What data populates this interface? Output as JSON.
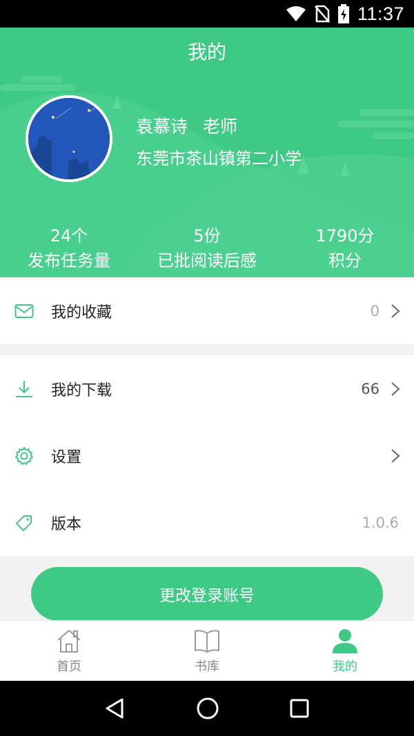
{
  "status_bar": {
    "time": "11:37"
  },
  "header": {
    "title": "我的",
    "name": "袁慕诗",
    "role": "老师",
    "school": "东莞市茶山镇第二小学",
    "stats": [
      {
        "value": "24个",
        "label": "发布任务量"
      },
      {
        "value": "5份",
        "label": "已批阅读后感"
      },
      {
        "value": "1790分",
        "label": "积分"
      }
    ]
  },
  "menu": {
    "favorites": {
      "label": "我的收藏",
      "value": "0",
      "icon": "mail-icon"
    },
    "downloads": {
      "label": "我的下载",
      "value": "66",
      "icon": "download-icon"
    },
    "settings": {
      "label": "设置",
      "icon": "gear-icon"
    },
    "version": {
      "label": "版本",
      "value": "1.0.6",
      "icon": "tag-icon"
    }
  },
  "button": {
    "change_account": "更改登录账号"
  },
  "tabs": [
    {
      "label": "首页",
      "icon": "home-icon"
    },
    {
      "label": "书库",
      "icon": "book-icon"
    },
    {
      "label": "我的",
      "icon": "user-icon",
      "active": true
    }
  ],
  "colors": {
    "accent": "#3ec985",
    "background": "#f2f2f2"
  }
}
